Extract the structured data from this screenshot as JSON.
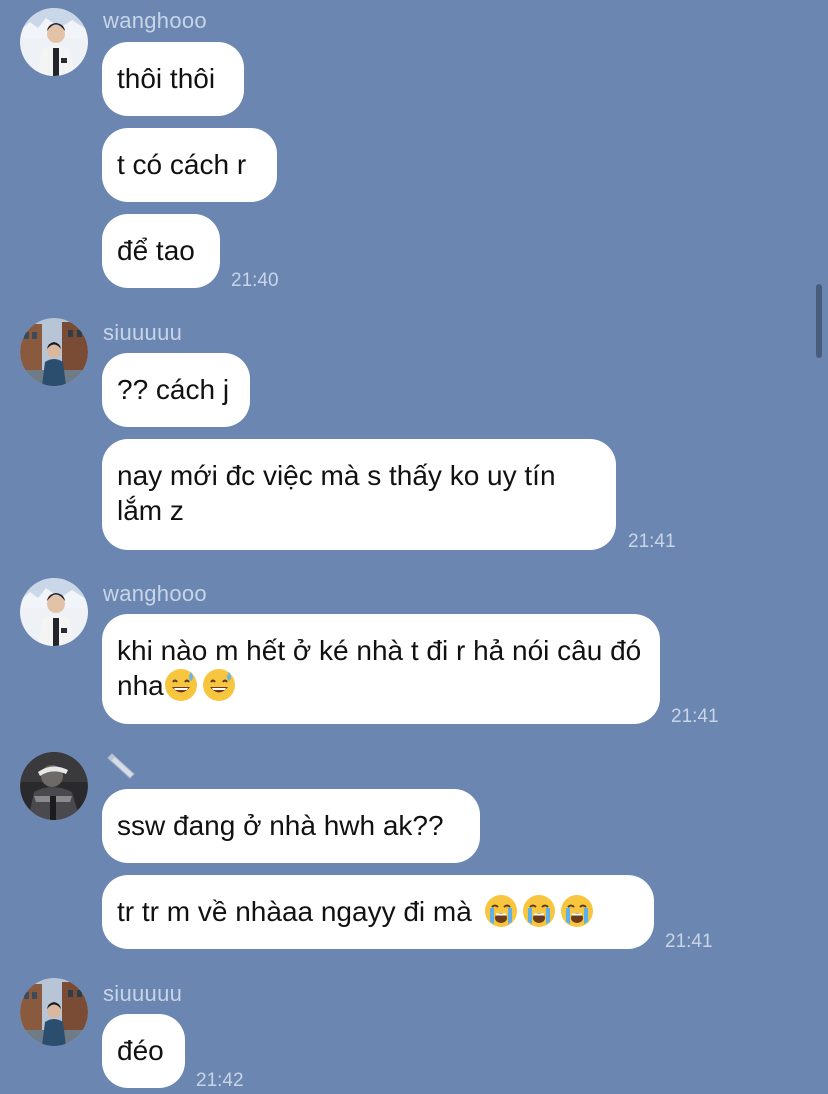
{
  "messages": [
    {
      "sender": "wanghooo",
      "avatar": "avatar-wanghooo",
      "bubbles": [
        "thôi thôi",
        "t có cách r",
        "để tao"
      ],
      "time": "21:40"
    },
    {
      "sender": "siuuuuu",
      "avatar": "avatar-siuuuuu",
      "bubbles": [
        "?? cách j",
        "nay mới đc việc mà s thấy ko uy tín lắm z"
      ],
      "time": "21:41"
    },
    {
      "sender": "wanghooo",
      "avatar": "avatar-wanghooo",
      "bubbles": [
        "khi nào m hết ở ké nhà t đi r hả nói câu đó nha"
      ],
      "emojis": [
        "sweat-smile-emoji",
        "sweat-smile-emoji"
      ],
      "time": "21:41"
    },
    {
      "sender": "",
      "sender_icon": "pencil-icon",
      "avatar": "avatar-dark-figure",
      "bubbles": [
        "ssw đang ở nhà hwh ak??",
        "tr tr m về nhàaa ngayy đi mà"
      ],
      "emojis": [
        "crying-face-emoji",
        "crying-face-emoji",
        "crying-face-emoji"
      ],
      "time": "21:41"
    },
    {
      "sender": "siuuuuu",
      "avatar": "avatar-siuuuuu",
      "bubbles": [
        "đéo"
      ],
      "time": "21:42"
    }
  ],
  "colors": {
    "background": "#6b87b1",
    "bubble": "#ffffff",
    "meta_text": "#c8d5e8"
  }
}
